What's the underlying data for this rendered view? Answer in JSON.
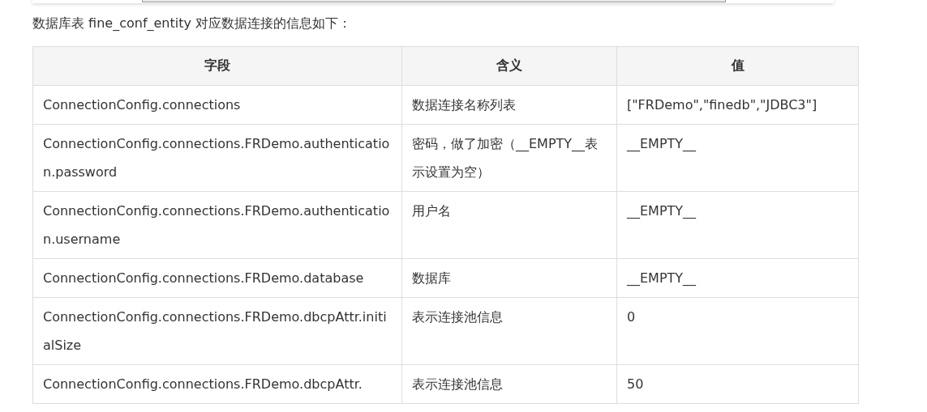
{
  "intro": "数据库表 fine_conf_entity 对应数据连接的信息如下：",
  "table": {
    "columns": [
      "字段",
      "含义",
      "值"
    ],
    "rows": [
      {
        "cells": [
          "ConnectionConfig.connections",
          "数据连接名称列表",
          "[\"FRDemo\",\"finedb\",\"JDBC3\"]"
        ]
      },
      {
        "cells": [
          "ConnectionConfig.connections.FRDemo.authentication.password",
          "密码，做了加密（__EMPTY__表示设置为空）",
          "__EMPTY__"
        ]
      },
      {
        "cells": [
          "ConnectionConfig.connections.FRDemo.authentication.username",
          "用户名",
          "__EMPTY__"
        ]
      },
      {
        "cells": [
          "ConnectionConfig.connections.FRDemo.database",
          "数据库",
          "__EMPTY__"
        ]
      },
      {
        "cells": [
          "ConnectionConfig.connections.FRDemo.dbcpAttr.initialSize",
          "表示连接池信息",
          "0"
        ]
      },
      {
        "cells": [
          "ConnectionConfig.connections.FRDemo.dbcpAttr.",
          "表示连接池信息",
          "50"
        ]
      }
    ]
  }
}
